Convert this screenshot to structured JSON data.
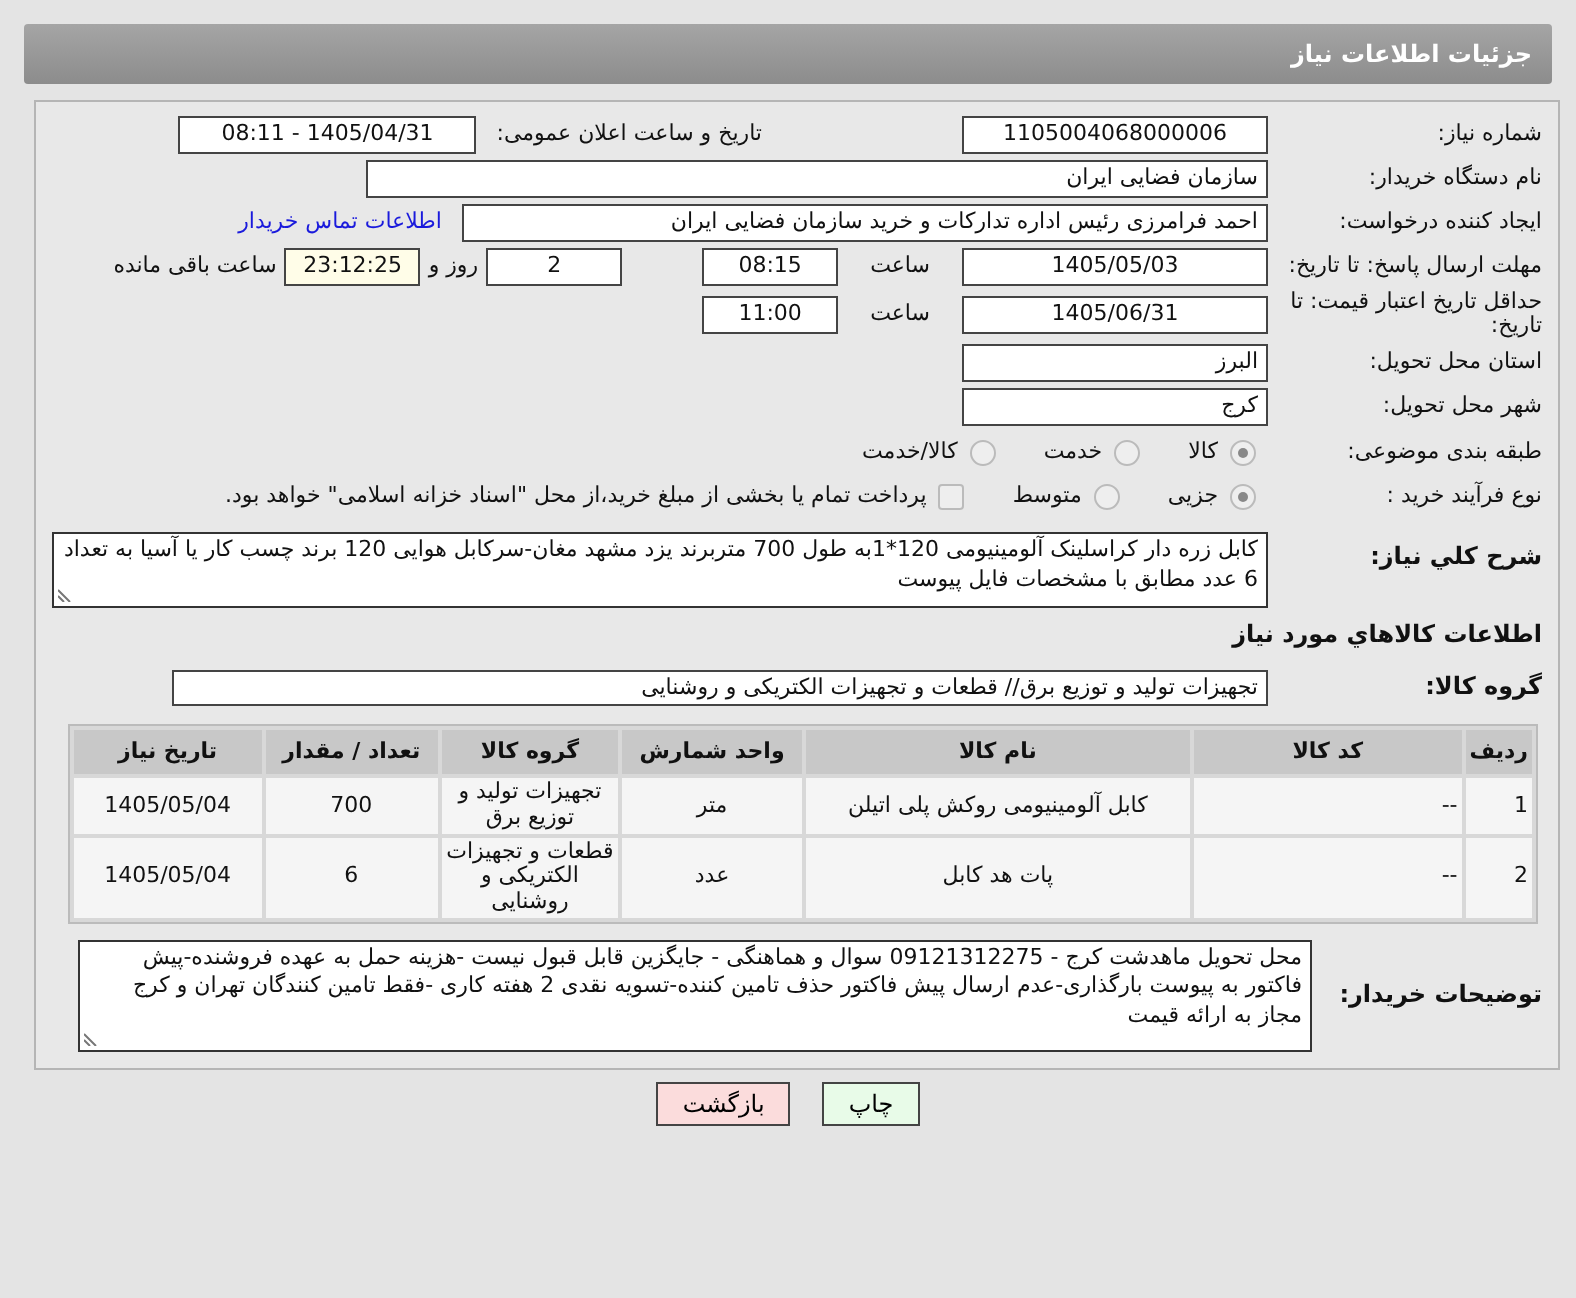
{
  "page_title": "جزئیات اطلاعات نیاز",
  "need_number": {
    "label": "شماره نیاز:",
    "value": "1105004068000006"
  },
  "announce": {
    "label": "تاریخ و ساعت اعلان عمومی:",
    "value": "1405/04/31 - 08:11"
  },
  "buyer_org": {
    "label": "نام دستگاه خریدار:",
    "value": "سازمان فضایی ایران"
  },
  "requester": {
    "label": "ایجاد کننده درخواست:",
    "value": "احمد فرامرزی رئیس اداره تداركات و خرید سازمان فضایی ایران",
    "link": "اطلاعات تماس خریدار"
  },
  "reply_deadline": {
    "label": "مهلت ارسال پاسخ: تا تاریخ:",
    "date": "1405/05/03",
    "time_label": "ساعت",
    "time": "08:15",
    "days": "2",
    "days_label": "روز و",
    "remaining": "23:12:25",
    "remaining_label": "ساعت باقی مانده"
  },
  "price_validity": {
    "label": "حداقل تاریخ اعتبار قیمت: تا تاریخ:",
    "date": "1405/06/31",
    "time_label": "ساعت",
    "time": "11:00"
  },
  "province": {
    "label": "استان محل تحویل:",
    "value": "البرز"
  },
  "city": {
    "label": "شهر محل تحویل:",
    "value": "کرج"
  },
  "category": {
    "label": "طبقه بندی موضوعی:",
    "options": [
      {
        "label": "کالا",
        "selected": true
      },
      {
        "label": "خدمت",
        "selected": false
      },
      {
        "label": "کالا/خدمت",
        "selected": false
      }
    ]
  },
  "process": {
    "label": "نوع فرآیند خرید :",
    "options": [
      {
        "label": "جزیی",
        "selected": true
      },
      {
        "label": "متوسط",
        "selected": false
      }
    ],
    "payment": {
      "label": "پرداخت تمام یا بخشی از مبلغ خرید،از محل \"اسناد خزانه اسلامی\" خواهد بود.",
      "checked": false
    }
  },
  "description": {
    "label": "شرح کلي نیاز:",
    "value": "کابل زره دار کراسلینک آلومینیومی 120*1به طول 700 متربرند یزد مشهد مغان-سرکابل هوایی 120 برند چسب کار یا آسیا به تعداد 6 عدد مطابق با مشخصات فایل پیوست"
  },
  "goods_heading": "اطلاعات کالاهاي مورد نیاز",
  "goods_group": {
    "label": "گروه کالا:",
    "value": "تجهیزات تولید و توزیع برق// قطعات و تجهیزات الکتریکی و روشنایی"
  },
  "table": {
    "columns": [
      "ردیف",
      "کد کالا",
      "نام کالا",
      "واحد شمارش",
      "گروه کالا",
      "تعداد / مقدار",
      "تاریخ نیاز"
    ],
    "rows": [
      [
        "1",
        "--",
        "کابل آلومینیومی روکش پلی اتیلن",
        "متر",
        "تجهیزات تولید و توزیع برق",
        "700",
        "1405/05/04"
      ],
      [
        "2",
        "--",
        "پات هد کابل",
        "عدد",
        "قطعات و تجهیزات الکتریکی و روشنایی",
        "6",
        "1405/05/04"
      ]
    ]
  },
  "buyer_notes": {
    "label": "توضیحات خریدار:",
    "value": "محل تحویل ماهدشت کرج - 09121312275 سوال و هماهنگی - جایگزین قابل قبول نیست -هزینه حمل به عهده فروشنده-پیش فاکتور به پیوست بارگذاری-عدم ارسال پیش فاکتور حذف تامین کننده-تسویه نقدی 2 هفته کاری -فقط تامین کنندگان تهران و کرج مجاز به ارائه قیمت"
  },
  "buttons": [
    {
      "label": "چاپ",
      "kind": "print"
    },
    {
      "label": "بازگشت",
      "kind": "back"
    }
  ]
}
